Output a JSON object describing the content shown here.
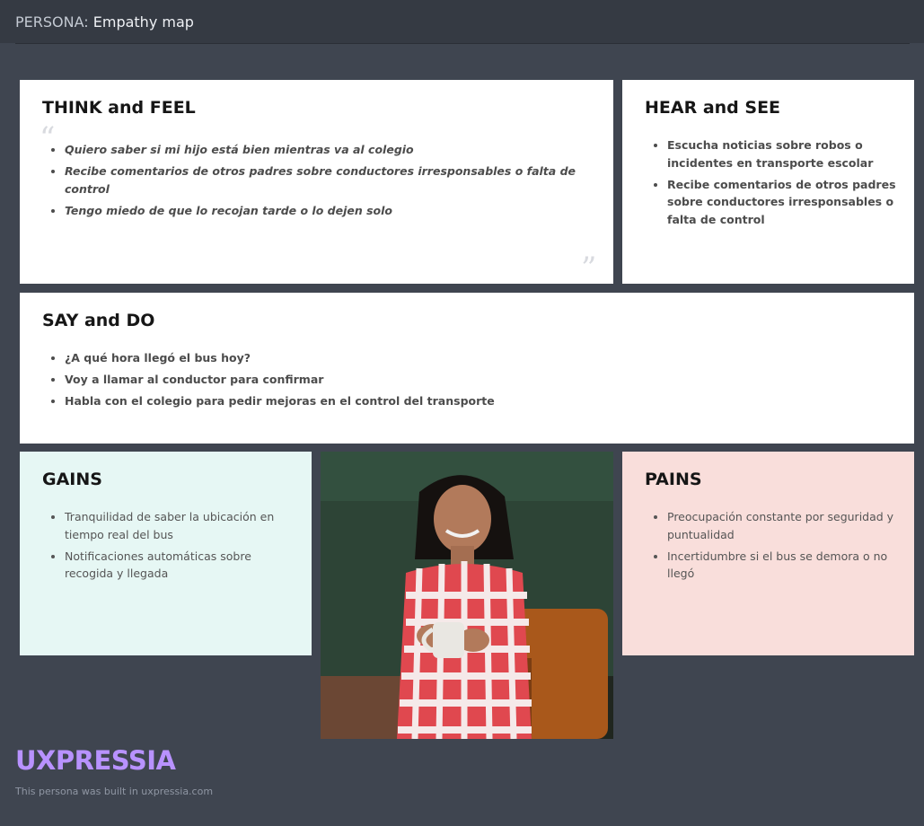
{
  "header": {
    "prefix": "PERSONA:",
    "title": "Empathy map"
  },
  "think_feel": {
    "title": "THINK and FEEL",
    "items": [
      "Quiero saber si mi hijo está bien mientras va al colegio",
      "Recibe comentarios de otros padres sobre conductores irresponsables o falta de control",
      "Tengo miedo de que lo recojan tarde o lo dejen solo"
    ]
  },
  "hear_see": {
    "title": "HEAR and SEE",
    "items": [
      "Escucha noticias sobre robos o incidentes en transporte escolar",
      "Recibe comentarios de otros padres sobre conductores irresponsables o falta de control"
    ]
  },
  "say_do": {
    "title": "SAY and DO",
    "items": [
      "¿A qué hora llegó el bus hoy?",
      "Voy a llamar al conductor para confirmar",
      "Habla con el colegio para pedir mejoras en el control del transporte"
    ]
  },
  "gains": {
    "title": "GAINS",
    "items": [
      "Tranquilidad de saber la ubicación en tiempo real del bus",
      "Notificaciones automáticas sobre recogida y llegada"
    ]
  },
  "pains": {
    "title": "PAINS",
    "items": [
      "Preocupación constante por seguridad y puntualidad",
      "Incertidumbre si el bus se demora o no llegó"
    ]
  },
  "footer": {
    "logo": "UXPRESSIA",
    "note": "This persona was built in uxpressia.com"
  },
  "colors": {
    "background": "#3f4550",
    "header": "#353a43",
    "gains_bg": "#e6f7f4",
    "pains_bg": "#f9dedb",
    "brand": "#b892ff"
  },
  "icons": {
    "open_quote": "open-quote-icon",
    "close_quote": "close-quote-icon"
  }
}
